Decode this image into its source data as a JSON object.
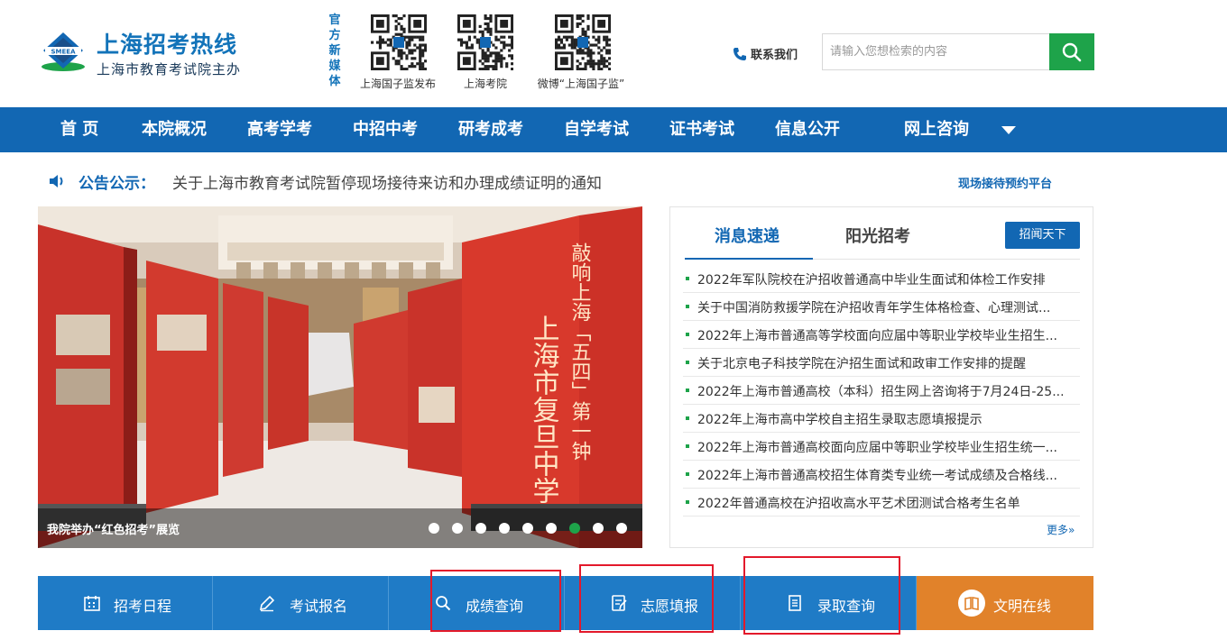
{
  "site": {
    "title": "上海招考热线",
    "subtitle": "上海市教育考试院主办",
    "emblem_text": "SMEEA"
  },
  "media": {
    "label": "官方新媒体",
    "qrs": [
      {
        "caption": "上海国子监发布"
      },
      {
        "caption": "上海考院"
      },
      {
        "caption": "微博“上海国子监”"
      }
    ]
  },
  "header": {
    "contact_label": "联系我们",
    "search_placeholder": "请输入您想检索的内容"
  },
  "nav": {
    "items": [
      "首 页",
      "本院概况",
      "高考学考",
      "中招中考",
      "研考成考",
      "自学考试",
      "证书考试",
      "信息公开",
      "网上咨询"
    ]
  },
  "notice": {
    "label": "公告公示：",
    "text": "关于上海市教育考试院暂停现场接待来访和办理成绩证明的通知",
    "booking_link": "现场接待预约平台"
  },
  "carousel": {
    "caption": "我院举办“红色招考”展览",
    "dot_count": 9,
    "active_dot": 7,
    "panel_text_main": "上海市复旦中学",
    "panel_text_side": "敲响上海「五四」第一钟"
  },
  "news": {
    "tabs": [
      "消息速递",
      "阳光招考"
    ],
    "button": "招闻天下",
    "items": [
      "2022年军队院校在沪招收普通高中毕业生面试和体检工作安排",
      "关于中国消防救援学院在沪招收青年学生体格检查、心理测试...",
      "2022年上海市普通高等学校面向应届中等职业学校毕业生招生...",
      "关于北京电子科技学院在沪招生面试和政审工作安排的提醒",
      "2022年上海市普通高校（本科）招生网上咨询将于7月24日-25...",
      "2022年上海市高中学校自主招生录取志愿填报提示",
      "2022年上海市普通高校面向应届中等职业学校毕业生招生统一...",
      "2022年上海市普通高校招生体育类专业统一考试成绩及合格线...",
      "2022年普通高校在沪招收高水平艺术团测试合格考生名单"
    ],
    "more": "更多»"
  },
  "quick_links": [
    {
      "label": "招考日程",
      "icon": "calendar-icon"
    },
    {
      "label": "考试报名",
      "icon": "pencil-icon"
    },
    {
      "label": "成绩查询",
      "icon": "search-icon"
    },
    {
      "label": "志愿填报",
      "icon": "form-icon"
    },
    {
      "label": "录取查询",
      "icon": "document-icon"
    },
    {
      "label": "文明在线",
      "icon": "book-icon"
    }
  ],
  "colors": {
    "brand_blue": "#1267b3",
    "accent_green": "#1ea34a",
    "quick_blue": "#1f7bc6",
    "quick_orange": "#e1822a",
    "highlight_red": "#e3192b"
  }
}
